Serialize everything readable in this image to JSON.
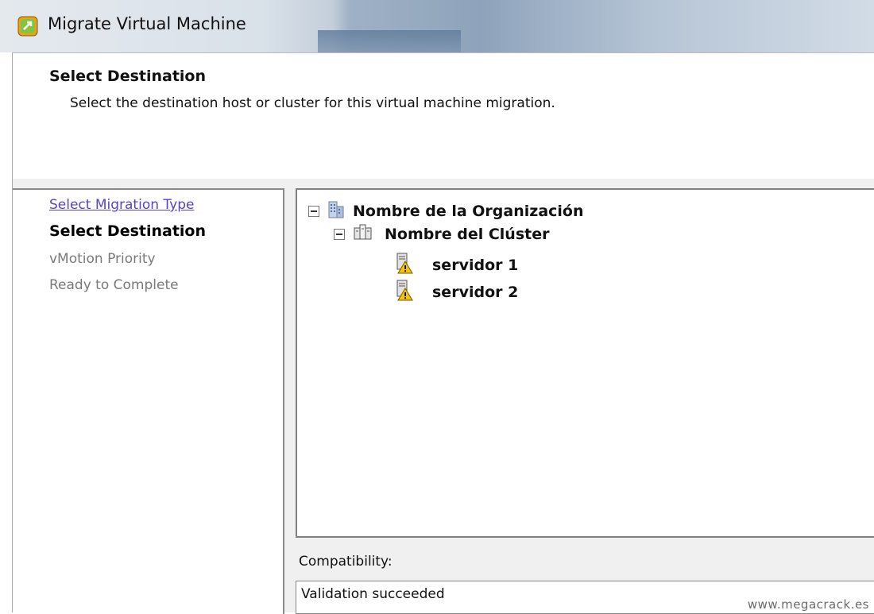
{
  "window": {
    "title": "Migrate Virtual Machine",
    "icon": "vmware-migrate-icon"
  },
  "header": {
    "title": "Select Destination",
    "subtitle": "Select the destination host or cluster for this virtual machine migration."
  },
  "steps": [
    {
      "label": "Select Migration Type",
      "state": "link"
    },
    {
      "label": "Select Destination",
      "state": "current"
    },
    {
      "label": "vMotion Priority",
      "state": "disabled"
    },
    {
      "label": "Ready to Complete",
      "state": "disabled"
    }
  ],
  "tree": {
    "organization": "Nombre de la Organización",
    "cluster": "Nombre del Clúster",
    "hosts": [
      {
        "label": "servidor 1"
      },
      {
        "label": "servidor 2"
      }
    ]
  },
  "compatibility": {
    "label": "Compatibility:",
    "value": "Validation succeeded"
  },
  "watermark": "www.megacrack.es"
}
